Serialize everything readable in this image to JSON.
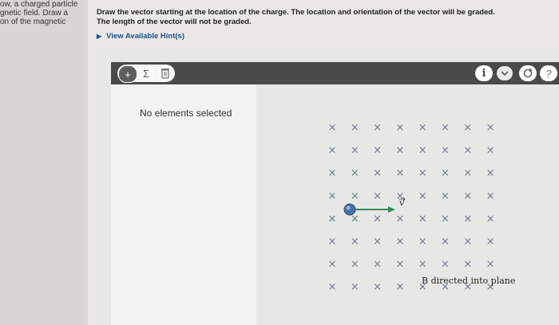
{
  "left_partial_lines": [
    "ow, a charged particle",
    "gnetic field. Draw a",
    "on of the magnetic"
  ],
  "instructions": {
    "line1": "Draw the vector starting at the location of the charge. The location and orientation of the vector will be graded.",
    "line2": "The length of the vector will not be graded."
  },
  "hint_label": "View Available Hint(s)",
  "toolbar": {
    "add_icon": "+",
    "sum_icon": "Σ",
    "delete_icon": "trash",
    "info_icon": "i",
    "dropdown_icon": "chevron-down",
    "reset_icon": "reset",
    "help_icon": "?"
  },
  "sidebar": {
    "status": "No elements selected"
  },
  "canvas": {
    "field_symbol": "×",
    "velocity_label": "v",
    "field_caption": "B directed into plane"
  },
  "colors": {
    "toolbar_bg": "#4a4a4a",
    "field_x": "#6b7a8f",
    "charge": "#4a6fa5",
    "velocity_arrow": "#2e8b57"
  }
}
